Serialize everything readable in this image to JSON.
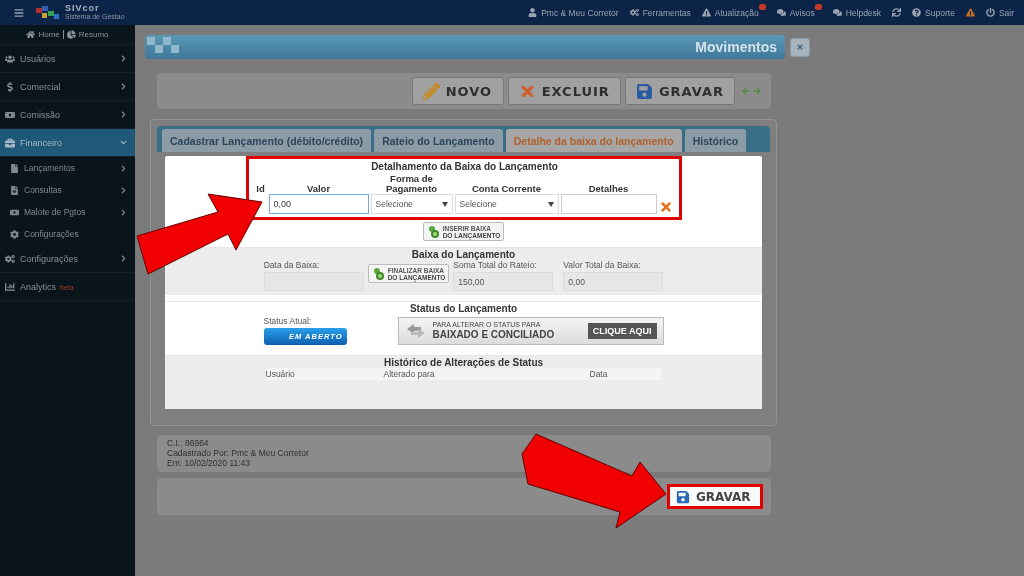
{
  "topbar": {
    "brand": "SIVcor",
    "tagline": "Sistema de Gestao",
    "links": [
      {
        "label": "Pmc & Meu Corretor",
        "badge": false
      },
      {
        "label": "Ferramentas",
        "badge": false
      },
      {
        "label": "Atualização",
        "badge": true
      },
      {
        "label": "Avisos",
        "badge": true
      },
      {
        "label": "Helpdesk",
        "badge": false
      },
      {
        "badge": false
      },
      {
        "label": "Suporte",
        "badge": false
      },
      {
        "badge": false
      },
      {
        "label": "Sair",
        "badge": false
      }
    ]
  },
  "sidebar": {
    "home": "Home",
    "summary": "Resumo",
    "items": [
      {
        "label": "Usuários",
        "kind": "menu",
        "selected": false,
        "expanded": false
      },
      {
        "label": "Comercial",
        "kind": "menu",
        "selected": false,
        "expanded": false
      },
      {
        "label": "Comissão",
        "kind": "menu",
        "selected": false,
        "expanded": false
      },
      {
        "label": "Financeiro",
        "kind": "menu",
        "selected": true,
        "expanded": true,
        "children": [
          {
            "label": "Lançamentos",
            "kind": "menu"
          },
          {
            "label": "Consultas",
            "kind": "menu"
          },
          {
            "label": "Malote de Pgtos",
            "kind": "menu"
          },
          {
            "label": "Configurações",
            "kind": "link"
          }
        ]
      },
      {
        "label": "Configurações",
        "kind": "menu",
        "selected": false,
        "expanded": false
      },
      {
        "label": "Analytics",
        "kind": "link",
        "tag": "beta",
        "selected": false
      }
    ]
  },
  "page": {
    "title": "Movimentos",
    "toolbar": [
      {
        "label": "NOVO"
      },
      {
        "label": "EXCLUIR"
      },
      {
        "label": "GRAVAR"
      }
    ],
    "tabs": [
      {
        "label": "Cadastrar Lançamento (débito/crédito)",
        "selected": false
      },
      {
        "label": "Rateio do Lançamento",
        "selected": false
      },
      {
        "label": "Detalhe da baixa do lançamento",
        "selected": true
      },
      {
        "label": "Histórico",
        "selected": false
      }
    ],
    "detail": {
      "title": "Detalhamento da Baixa do Lançamento",
      "highlighted": true,
      "columns": [
        "Id",
        "Valor",
        "Forma de Pagamento",
        "Conta Corrente",
        "Detalhes"
      ],
      "valor": "0,00",
      "forma_pagamento": "Selecione",
      "conta_corrente": "Selecione",
      "insert_button": [
        "INSERIR BAIXA",
        "DO LANÇAMENTO"
      ]
    },
    "baixa": {
      "title": "Baixa do Lançamento",
      "data_label": "Data da Baixa:",
      "finalize_button": [
        "FINALIZAR BAIXA",
        "DO LANÇAMENTO"
      ],
      "soma_label": "Soma Total do Rateio:",
      "soma_value": "150,00",
      "valor_label": "Valor Total da Baixa:",
      "valor_value": "0,00"
    },
    "status": {
      "title": "Status do Lançamento",
      "label": "Status Atual:",
      "value": "EM ABERTO",
      "change_button": {
        "line1": "PARA ALTERAR O STATUS PARA",
        "line2": "BAIXADO E CONCILIADO",
        "action": "CLIQUE AQUI"
      }
    },
    "history": {
      "title": "Histórico de Alterações de Status",
      "columns": [
        "Usuário",
        "Alterado para",
        "Data"
      ]
    },
    "info": [
      "C.I.: 86964",
      "Cadastrado Por: Pmc & Meu Corretor",
      "Em: 10/02/2020 11:43"
    ],
    "save_button": {
      "label": "GRAVAR",
      "highlighted": true
    }
  }
}
